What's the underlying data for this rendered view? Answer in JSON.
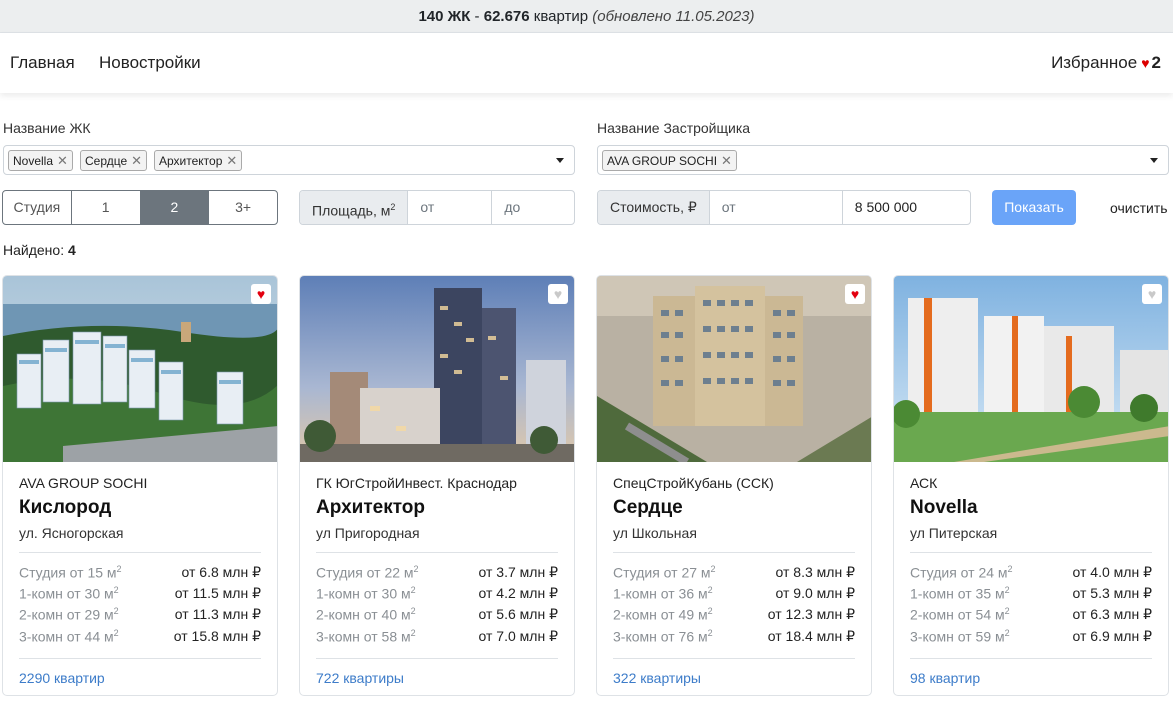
{
  "topbar": {
    "count_jk": "140 ЖК",
    "sep": " - ",
    "count_flats": "62.676",
    "flats_word": " квартир ",
    "updated": "(обновлено 11.05.2023)"
  },
  "nav": {
    "home": "Главная",
    "new": "Новостройки",
    "favorites_label": "Избранное",
    "favorites_count": "2"
  },
  "filters": {
    "jk_label": "Название ЖК",
    "jk_tags": [
      "Novella",
      "Сердце",
      "Архитектор"
    ],
    "dev_label": "Название Застройщика",
    "dev_tags": [
      "AVA GROUP SOCHI"
    ],
    "rooms": [
      "Студия",
      "1",
      "2",
      "3+"
    ],
    "rooms_active": "2",
    "area_label": "Площадь, м",
    "area_sup": "2",
    "area_from_placeholder": "от",
    "area_to_placeholder": "до",
    "price_label": "Стоимость, ₽",
    "price_from_placeholder": "от",
    "price_to_value": "8 500 000",
    "show": "Показать",
    "clear": "очистить"
  },
  "found": {
    "label": "Найдено: ",
    "count": "4"
  },
  "cards": [
    {
      "developer": "AVA GROUP SOCHI",
      "name": "Кислород",
      "address": "ул. Ясногорская",
      "favorite": true,
      "rows": [
        {
          "type": "Студия от 15 м",
          "price": "от 6.8 млн ₽"
        },
        {
          "type": "1-комн от 30 м",
          "price": "от 11.5 млн ₽"
        },
        {
          "type": "2-комн от 29 м",
          "price": "от 11.3 млн ₽"
        },
        {
          "type": "3-комн от 44 м",
          "price": "от 15.8 млн ₽"
        }
      ],
      "flats": "2290 квартир"
    },
    {
      "developer": "ГК ЮгСтройИнвест. Краснодар",
      "name": "Архитектор",
      "address": "ул Пригородная",
      "favorite": false,
      "rows": [
        {
          "type": "Студия от 22 м",
          "price": "от 3.7 млн ₽"
        },
        {
          "type": "1-комн от 30 м",
          "price": "от 4.2 млн ₽"
        },
        {
          "type": "2-комн от 40 м",
          "price": "от 5.6 млн ₽"
        },
        {
          "type": "3-комн от 58 м",
          "price": "от 7.0 млн ₽"
        }
      ],
      "flats": "722 квартиры"
    },
    {
      "developer": "СпецСтройКубань (ССК)",
      "name": "Сердце",
      "address": "ул Школьная",
      "favorite": true,
      "rows": [
        {
          "type": "Студия от 27 м",
          "price": "от 8.3 млн ₽"
        },
        {
          "type": "1-комн от 36 м",
          "price": "от 9.0 млн ₽"
        },
        {
          "type": "2-комн от 49 м",
          "price": "от 12.3 млн ₽"
        },
        {
          "type": "3-комн от 76 м",
          "price": "от 18.4 млн ₽"
        }
      ],
      "flats": "322 квартиры"
    },
    {
      "developer": "АСК",
      "name": "Novella",
      "address": "ул Питерская",
      "favorite": false,
      "rows": [
        {
          "type": "Студия от 24 м",
          "price": "от 4.0 млн ₽"
        },
        {
          "type": "1-комн от 35 м",
          "price": "от 5.3 млн ₽"
        },
        {
          "type": "2-комн от 54 м",
          "price": "от 6.3 млн ₽"
        },
        {
          "type": "3-комн от 59 м",
          "price": "от 6.9 млн ₽"
        }
      ],
      "flats": "98 квартир"
    }
  ],
  "sup": "2",
  "heart": "♥",
  "tag_close": "✕"
}
